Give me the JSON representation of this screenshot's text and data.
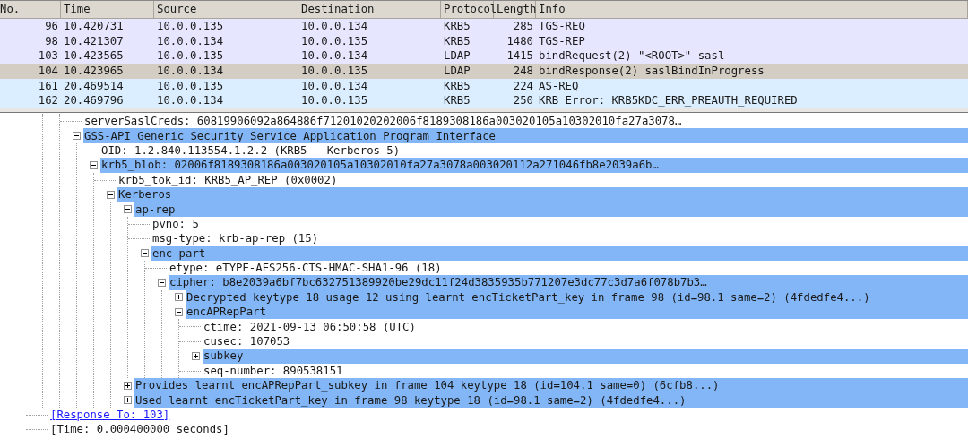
{
  "packet_list": {
    "columns": [
      "No.",
      "Time",
      "Source",
      "Destination",
      "Protocol",
      "Length",
      "Info"
    ],
    "rows": [
      {
        "no": "96",
        "time": "10.420731",
        "source": "10.0.0.135",
        "destination": "10.0.0.134",
        "protocol": "KRB5",
        "length": "285",
        "info": "TGS-REQ",
        "color": "#e7e6ff",
        "selected": false
      },
      {
        "no": "98",
        "time": "10.421307",
        "source": "10.0.0.134",
        "destination": "10.0.0.135",
        "protocol": "KRB5",
        "length": "1480",
        "info": "TGS-REP",
        "color": "#e7e6ff",
        "selected": false
      },
      {
        "no": "103",
        "time": "10.423565",
        "source": "10.0.0.135",
        "destination": "10.0.0.134",
        "protocol": "LDAP",
        "length": "1415",
        "info": "bindRequest(2) \"<ROOT>\" sasl",
        "color": "#e7e6ff",
        "selected": false
      },
      {
        "no": "104",
        "time": "10.423965",
        "source": "10.0.0.134",
        "destination": "10.0.0.135",
        "protocol": "LDAP",
        "length": "248",
        "info": "bindResponse(2) saslBindInProgress",
        "selected": true
      },
      {
        "no": "161",
        "time": "20.469514",
        "source": "10.0.0.135",
        "destination": "10.0.0.134",
        "protocol": "KRB5",
        "length": "224",
        "info": "AS-REQ",
        "color": "#daeeff",
        "selected": false
      },
      {
        "no": "162",
        "time": "20.469796",
        "source": "10.0.0.134",
        "destination": "10.0.0.135",
        "protocol": "KRB5",
        "length": "250",
        "info": "KRB Error: KRB5KDC_ERR_PREAUTH_REQUIRED",
        "color": "#daeeff",
        "selected": false
      }
    ]
  },
  "detail_tree": [
    {
      "children": [
        {
          "children": [
            {
              "label": "serverSaslCreds: 60819906092a864886f71201020202006f8189308186a003020105a10302010fa27a3078…",
              "highlighted": false
            },
            {
              "label": "GSS-API Generic Security Service Application Program Interface",
              "highlighted": true,
              "expanded": true,
              "children": [
                {
                  "label": "OID: 1.2.840.113554.1.2.2 (KRB5 - Kerberos 5)",
                  "highlighted": false
                },
                {
                  "label": "krb5_blob: 02006f8189308186a003020105a10302010fa27a3078a003020112a271046fb8e2039a6b…",
                  "highlighted": true,
                  "expanded": true,
                  "children": [
                    {
                      "label": "krb5_tok_id: KRB5_AP_REP (0x0002)",
                      "highlighted": false
                    },
                    {
                      "label": "Kerberos",
                      "highlighted": true,
                      "expanded": true,
                      "children": [
                        {
                          "label": "ap-rep",
                          "highlighted": true,
                          "expanded": true,
                          "children": [
                            {
                              "label": "pvno: 5",
                              "highlighted": false
                            },
                            {
                              "label": "msg-type: krb-ap-rep (15)",
                              "highlighted": false
                            },
                            {
                              "label": "enc-part",
                              "highlighted": true,
                              "expanded": true,
                              "children": [
                                {
                                  "label": "etype: eTYPE-AES256-CTS-HMAC-SHA1-96 (18)",
                                  "highlighted": false
                                },
                                {
                                  "label": "cipher: b8e2039a6bf7bc632751389920be29dc11f24d3835935b771207e3dc77c3d7a6f078b7b3…",
                                  "highlighted": true,
                                  "expanded": true,
                                  "children": [
                                    {
                                      "label": "Decrypted keytype 18 usage 12 using learnt encTicketPart_key in frame 98 (id=98.1 same=2) (4fdedfe4...)",
                                      "highlighted": true,
                                      "expanded": false
                                    },
                                    {
                                      "label": "encAPRepPart",
                                      "highlighted": true,
                                      "expanded": true,
                                      "children": [
                                        {
                                          "label": "ctime: 2021-09-13 06:50:58 (UTC)",
                                          "highlighted": false
                                        },
                                        {
                                          "label": "cusec: 107053",
                                          "highlighted": false
                                        },
                                        {
                                          "label": "subkey",
                                          "highlighted": true,
                                          "expanded": false
                                        },
                                        {
                                          "label": "seq-number: 890538151",
                                          "highlighted": false
                                        }
                                      ]
                                    }
                                  ]
                                }
                              ]
                            }
                          ]
                        },
                        {
                          "label": "Provides learnt encAPRepPart_subkey in frame 104 keytype 18 (id=104.1 same=0) (6cfb8...)",
                          "highlighted": true,
                          "expanded": false
                        },
                        {
                          "label": "Used learnt encTicketPart_key in frame 98 keytype 18 (id=98.1 same=2) (4fdedfe4...)",
                          "highlighted": true,
                          "expanded": false
                        }
                      ]
                    }
                  ]
                }
              ]
            }
          ]
        }
      ]
    },
    {
      "label": "[Response To: 103]",
      "highlighted": false,
      "kind": "link"
    },
    {
      "label": "[Time: 0.000400000 seconds]",
      "highlighted": false
    }
  ]
}
